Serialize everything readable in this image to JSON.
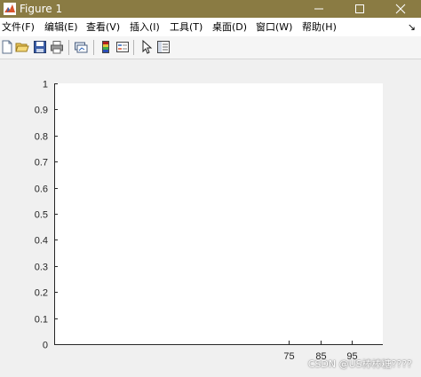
{
  "window": {
    "title": "Figure 1",
    "icon": "matlab-icon",
    "minimize_icon": "minimize-icon",
    "maximize_icon": "maximize-icon",
    "close_icon": "close-icon",
    "titlebar_color": "#8a7b43"
  },
  "menu": {
    "items": [
      "文件(F)",
      "编辑(E)",
      "查看(V)",
      "插入(I)",
      "工具(T)",
      "桌面(D)",
      "窗口(W)",
      "帮助(H)"
    ],
    "overflow_glyph": "↘"
  },
  "toolbar": {
    "buttons": [
      {
        "name": "new-figure",
        "icon": "new-file-icon"
      },
      {
        "name": "open-file",
        "icon": "folder-open-icon"
      },
      {
        "name": "save",
        "icon": "save-icon"
      },
      {
        "name": "print",
        "icon": "print-icon"
      },
      {
        "name": "link-plot",
        "icon": "link-plot-icon"
      },
      {
        "name": "insert-colorbar",
        "icon": "colorbar-icon"
      },
      {
        "name": "insert-legend",
        "icon": "legend-icon"
      },
      {
        "name": "edit-plot",
        "icon": "pointer-icon"
      },
      {
        "name": "property-inspector",
        "icon": "property-inspector-icon"
      }
    ]
  },
  "chart_data": {
    "type": "line",
    "title": "",
    "xlabel": "",
    "ylabel": "",
    "xlim": [
      0,
      105
    ],
    "ylim": [
      0,
      1
    ],
    "xticks": [
      75,
      85,
      95
    ],
    "yticks": [
      0,
      0.1,
      0.2,
      0.3,
      0.4,
      0.5,
      0.6,
      0.7,
      0.8,
      0.9,
      1
    ],
    "ytick_labels": [
      "0",
      "0.1",
      "0.2",
      "0.3",
      "0.4",
      "0.5",
      "0.6",
      "0.7",
      "0.8",
      "0.9",
      "1"
    ],
    "series": [],
    "grid": false,
    "axes_background": "#ffffff",
    "axis_color": "#262626"
  },
  "watermark": "CSDN @US棒棒糖????"
}
